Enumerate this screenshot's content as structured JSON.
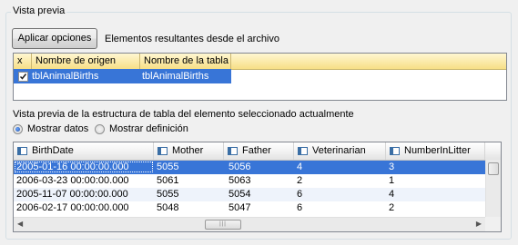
{
  "group_title": "Vista previa",
  "apply_button": "Aplicar opciones",
  "apply_caption": "Elementos resultantes desde el archivo",
  "source_grid": {
    "headers": [
      "x",
      "Nombre de origen",
      "Nombre de la tabla"
    ],
    "row": {
      "checked": true,
      "origin": "tblAnimalBirths",
      "table": "tblAnimalBirths"
    }
  },
  "structure_label": "Vista previa de la estructura de tabla del elemento seleccionado actualmente",
  "radios": {
    "show_data": "Mostrar datos",
    "show_definition": "Mostrar definición",
    "selected": "show_data"
  },
  "data_grid": {
    "columns": [
      "BirthDate",
      "Mother",
      "Father",
      "Veterinarian",
      "NumberInLitter"
    ],
    "rows": [
      [
        "2005-01-16 00:00:00.000",
        "5055",
        "5056",
        "4",
        "3"
      ],
      [
        "2006-03-23 00:00:00.000",
        "5061",
        "5063",
        "2",
        "1"
      ],
      [
        "2005-11-07 00:00:00.000",
        "5055",
        "5054",
        "6",
        "4"
      ],
      [
        "2006-02-17 00:00:00.000",
        "5048",
        "5047",
        "6",
        "2"
      ]
    ]
  },
  "colors": {
    "selection": "#3875d7",
    "header_yellow": "#f7df86"
  }
}
